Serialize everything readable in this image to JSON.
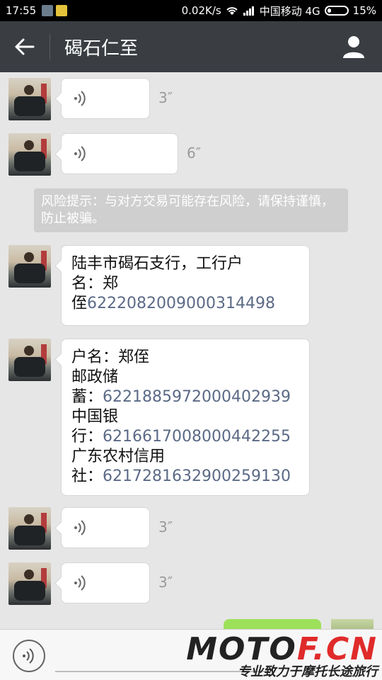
{
  "status_bar": {
    "time": "17:55",
    "network_speed": "0.02K/s",
    "carrier": "中国移动 4G",
    "battery": "15%"
  },
  "header": {
    "title": "碣石仁至"
  },
  "messages": {
    "voice1_duration": "3″",
    "voice2_duration": "6″",
    "notice": "风险提示：与对方交易可能存在风险，请保持谨慎，防止被骗。",
    "bank1": {
      "line1": "陆丰市碣石支行，工行户",
      "line2": "名：郑",
      "line3_prefix": "侄",
      "line3_number": "6222082009000314498"
    },
    "bank2": {
      "line1": "户名：郑侄",
      "line2": "邮政储",
      "line3_prefix": "蓄：",
      "line3_number": "6221885972000402939",
      "line4": "中国银",
      "line5_prefix": "行：",
      "line5_number": "6216617008000442255",
      "line6": "广东农村信用",
      "line7_prefix": "社：",
      "line7_number": "6217281632900259130"
    },
    "voice3_duration": "3″",
    "voice4_duration": "3″"
  },
  "watermark": {
    "brand_part1": "MOTO",
    "brand_part2": "F.CN",
    "slogan": "专业致力于摩托长途旅行"
  }
}
